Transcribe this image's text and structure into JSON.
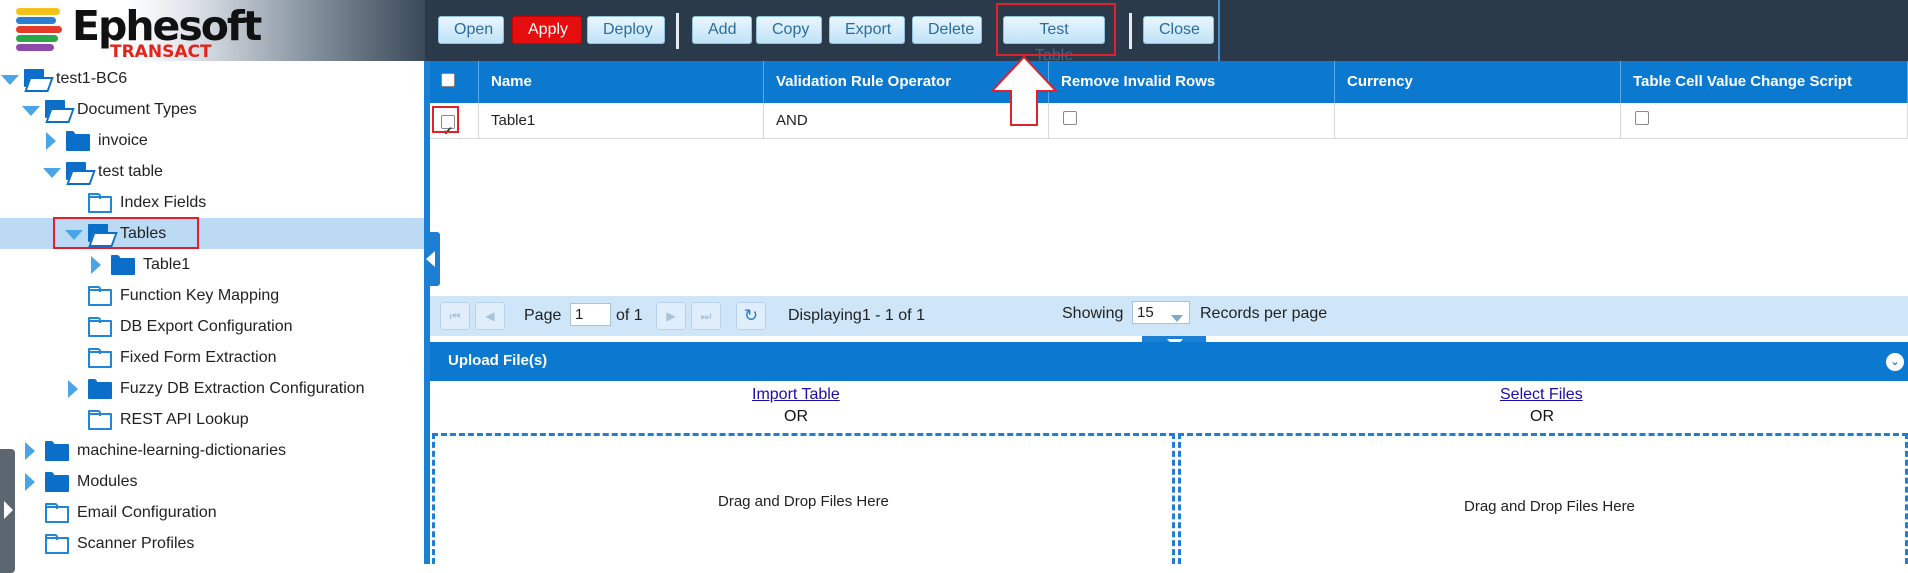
{
  "brand": {
    "name": "Ephesoft",
    "product": "TRANSACT"
  },
  "toolbar": {
    "buttons": [
      "Open",
      "Apply",
      "Deploy",
      "Add",
      "Copy",
      "Export",
      "Delete",
      "Test Table",
      "Close"
    ]
  },
  "tree": {
    "root": "test1-BC6",
    "document_types": "Document Types",
    "invoice": "invoice",
    "test_table": "test table",
    "index_fields": "Index Fields",
    "tables": "Tables",
    "table1": "Table1",
    "function_key_mapping": "Function Key Mapping",
    "db_export": "DB Export Configuration",
    "fixed_form": "Fixed Form Extraction",
    "fuzzy_db": "Fuzzy DB Extraction Configuration",
    "rest_api": "REST API Lookup",
    "ml_dictionaries": "machine-learning-dictionaries",
    "modules": "Modules",
    "email_config": "Email Configuration",
    "scanner_profiles": "Scanner Profiles"
  },
  "grid": {
    "columns": [
      "Name",
      "Validation Rule Operator",
      "Remove Invalid Rows",
      "Currency",
      "Table Cell Value Change Script"
    ],
    "rows": [
      {
        "selected": true,
        "name": "Table1",
        "operator": "AND",
        "remove_invalid_rows": false,
        "currency": "",
        "change_script": false
      }
    ]
  },
  "pager": {
    "page_label": "Page",
    "page_value": "1",
    "of_label": "of 1",
    "displaying": "Displaying1 - 1 of 1",
    "showing_label": "Showing",
    "per_page_value": "15",
    "records_label": "Records per page"
  },
  "upload": {
    "title": "Upload File(s)",
    "import_link": "Import Table",
    "select_link": "Select Files",
    "or": "OR",
    "drop_text": "Drag and Drop Files Here"
  },
  "colors": {
    "header_blue": "#0b79d0",
    "apply_red": "#e50d0d",
    "highlight_red": "#e0202a"
  }
}
